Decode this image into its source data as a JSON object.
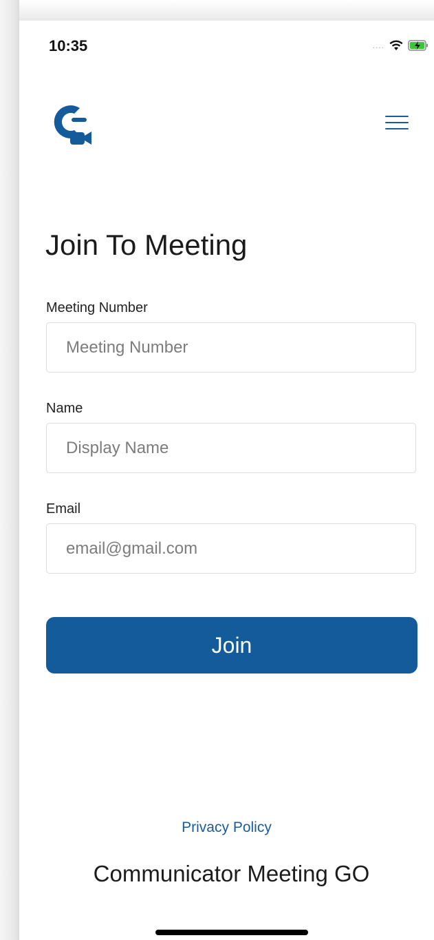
{
  "status_bar": {
    "time": "10:35",
    "signal_dots": "....",
    "wifi_icon": "wifi-icon",
    "battery_icon": "battery-charging-icon"
  },
  "header": {
    "logo_icon": "communicator-logo-icon",
    "menu_icon": "hamburger-menu-icon"
  },
  "page_title": "Join To Meeting",
  "form": {
    "meeting_number": {
      "label": "Meeting Number",
      "placeholder": "Meeting Number",
      "value": ""
    },
    "name": {
      "label": "Name",
      "placeholder": "Display Name",
      "value": ""
    },
    "email": {
      "label": "Email",
      "placeholder": "email@gmail.com",
      "value": ""
    }
  },
  "join_label": "Join",
  "footer": {
    "privacy_link": "Privacy Policy",
    "app_name": "Communicator Meeting GO"
  },
  "colors": {
    "accent": "#135b9b",
    "link": "#1a5c9b",
    "battery": "#3cc43c"
  }
}
